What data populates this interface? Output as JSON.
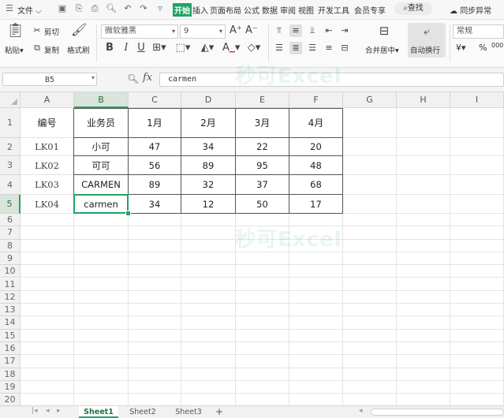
{
  "menubar": {
    "file_label": "文件",
    "tabs": [
      "开始",
      "插入",
      "页面布局",
      "公式",
      "数据",
      "审阅",
      "视图",
      "开发工具",
      "会员专享"
    ],
    "active_tab": "开始",
    "search_label": "查找",
    "sync_status": "同步异常"
  },
  "ribbon": {
    "cut_label": "剪切",
    "copy_label": "复制",
    "paste_label": "粘贴",
    "format_painter_label": "格式刷",
    "font_name": "微软雅黑",
    "font_size": "9",
    "merge_center_label": "合并居中",
    "wrap_text_label": "自动换行",
    "number_format": "常规",
    "currency_symbol": "¥",
    "percent_symbol": "%",
    "thousands_symbol": "000"
  },
  "formula_bar": {
    "name_box": "B5",
    "fx_label": "fx",
    "formula_value": "carmen"
  },
  "grid": {
    "columns": [
      "A",
      "B",
      "C",
      "D",
      "E",
      "F",
      "G",
      "H",
      "I"
    ],
    "rows": [
      "1",
      "2",
      "3",
      "4",
      "5",
      "6",
      "7",
      "8",
      "9",
      "10",
      "11",
      "12",
      "13",
      "14",
      "15",
      "16",
      "17",
      "18",
      "19",
      "20"
    ],
    "header_row": [
      "编号",
      "业务员",
      "1月",
      "2月",
      "3月",
      "4月"
    ],
    "data_rows": [
      [
        "LK01",
        "小可",
        "47",
        "34",
        "22",
        "20"
      ],
      [
        "LK02",
        "可可",
        "56",
        "89",
        "95",
        "48"
      ],
      [
        "LK03",
        "CARMEN",
        "89",
        "32",
        "37",
        "68"
      ],
      [
        "LK04",
        "carmen",
        "34",
        "12",
        "50",
        "17"
      ]
    ],
    "selected_cell": "B5"
  },
  "watermark_text": "秒可Excel",
  "sheets": [
    "Sheet1",
    "Sheet2",
    "Sheet3"
  ],
  "active_sheet": "Sheet1",
  "add_sheet_label": "+",
  "accent_color": "#21a366"
}
